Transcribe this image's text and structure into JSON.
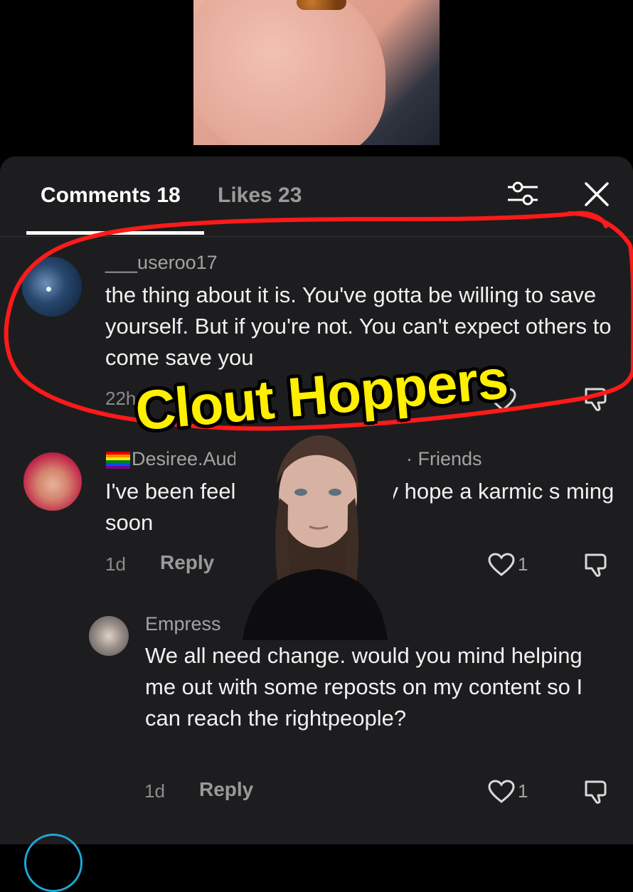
{
  "sheet": {
    "tabs": [
      {
        "label": "Comments 18",
        "active": true
      },
      {
        "label": "Likes 23",
        "active": false
      }
    ],
    "icons": {
      "filter": "sliders-icon",
      "close": "close-icon"
    }
  },
  "comments": [
    {
      "username": "___useroo17",
      "text": "the thing about it is. You've gotta be willing to save yourself. But if you're not. You can't expect others to come save you",
      "time": "22h",
      "reply_label": "Reply"
    },
    {
      "username": "Desiree.Audhd",
      "friends_label": "· Friends",
      "flag_icon": "rainbow-flag-icon",
      "text": "I've been feelin   t lately. I really hope a karmic s   ming soon",
      "time": "1d",
      "reply_label": "Reply",
      "likes": "1"
    },
    {
      "username": "Empress",
      "text": "We all need change. would you mind helping me out with some reposts on my content so I can reach the rightpeople?",
      "time": "1d",
      "reply_label": "Reply",
      "likes": "1"
    }
  ],
  "overlay": {
    "caption": "Clout Hoppers",
    "caption_color": "#ffef00",
    "highlight_color": "#ff1a1a"
  },
  "colors": {
    "sheet_bg": "#1d1d1f",
    "text": "#f1f1f1",
    "muted": "#9a9a9a"
  }
}
